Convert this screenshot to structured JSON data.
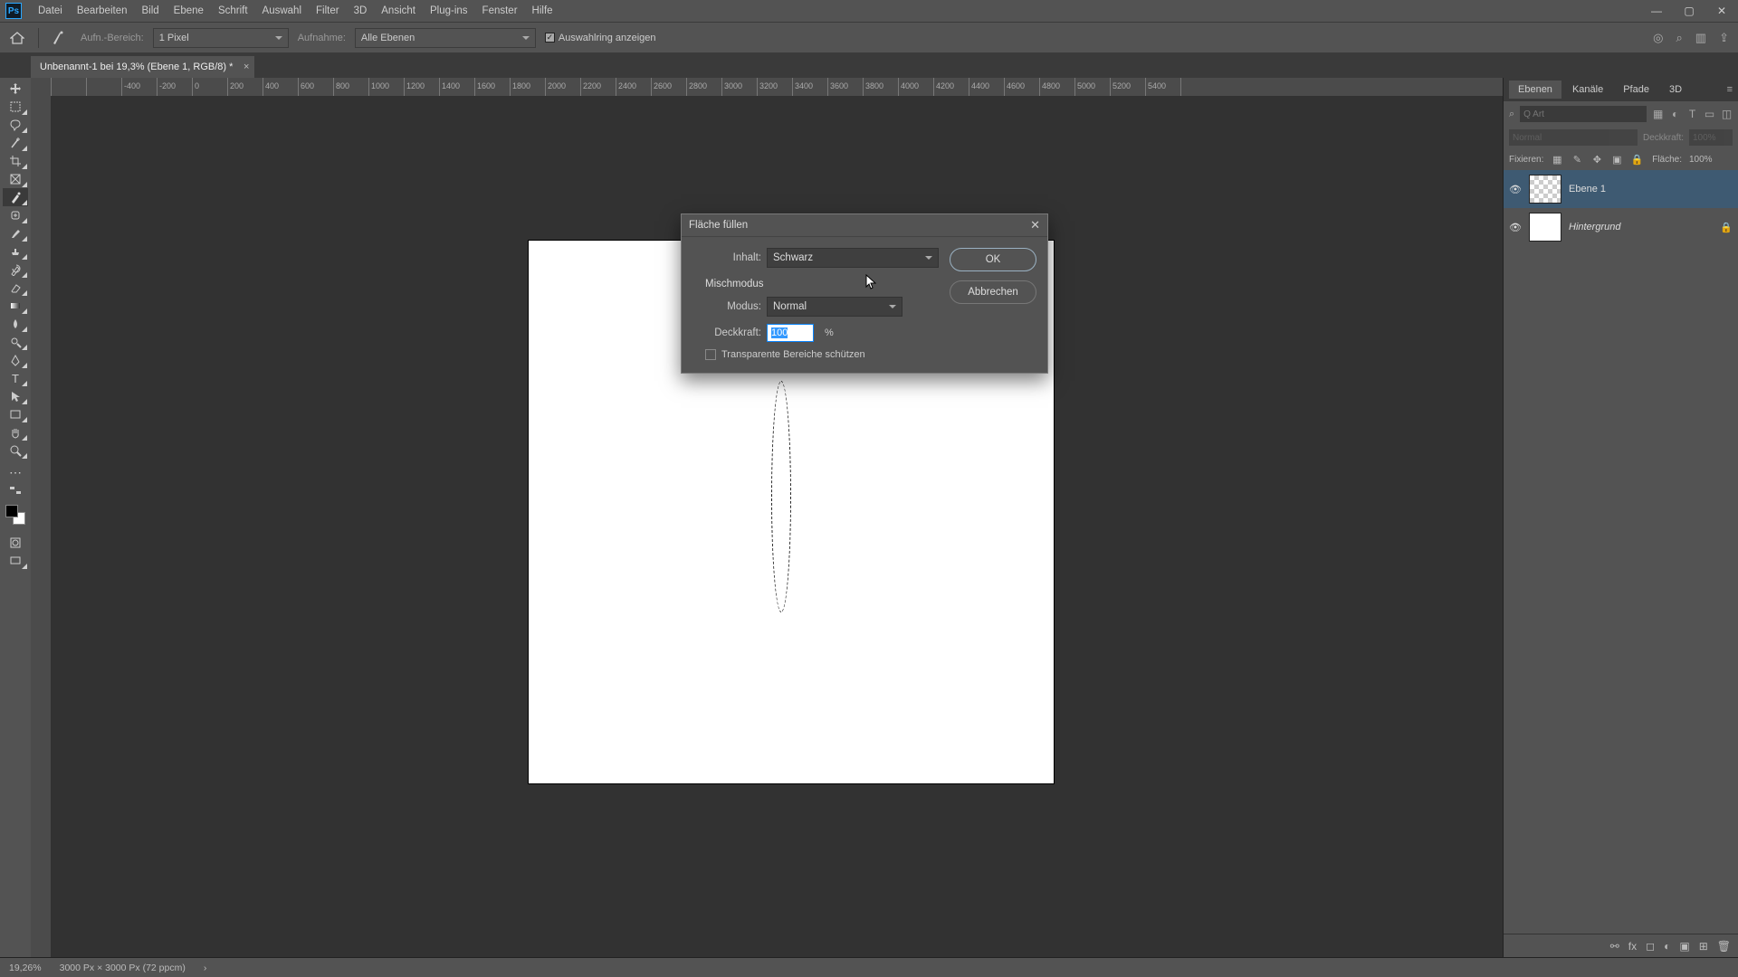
{
  "menu": [
    "Datei",
    "Bearbeiten",
    "Bild",
    "Ebene",
    "Schrift",
    "Auswahl",
    "Filter",
    "3D",
    "Ansicht",
    "Plug-ins",
    "Fenster",
    "Hilfe"
  ],
  "optbar": {
    "aufn_label": "Aufn.-Bereich:",
    "aufn_value": "1 Pixel",
    "aufnahme_label": "Aufnahme:",
    "aufnahme_value": "Alle Ebenen",
    "checkbox_label": "Auswahlring anzeigen"
  },
  "doc_tab": {
    "label": "Unbenannt-1 bei 19,3% (Ebene 1, RGB/8) *"
  },
  "ruler_ticks": [
    "",
    "",
    "-400",
    "-200",
    "0",
    "200",
    "400",
    "600",
    "800",
    "1000",
    "1200",
    "1400",
    "1600",
    "1800",
    "2000",
    "2200",
    "2400",
    "2600",
    "2800",
    "3000",
    "3200",
    "3400",
    "3600",
    "3800",
    "4000",
    "4200",
    "4400",
    "4600",
    "4800",
    "5000",
    "5200",
    "5400",
    ""
  ],
  "panels": {
    "tabs": [
      "Ebenen",
      "Kanäle",
      "Pfade",
      "3D"
    ],
    "search_placeholder": "Q Art",
    "blend_mode": "Normal",
    "opacity_label": "Deckkraft:",
    "opacity_value": "100%",
    "lock_label": "Fixieren:",
    "fill_label": "Fläche:",
    "fill_value": "100%",
    "layers": [
      {
        "name": "Ebene 1",
        "selected": true,
        "locked": false,
        "checker": true
      },
      {
        "name": "Hintergrund",
        "selected": false,
        "locked": true,
        "italic": true,
        "checker": false
      }
    ]
  },
  "dialog": {
    "title": "Fläche füllen",
    "inhalt_label": "Inhalt:",
    "inhalt_value": "Schwarz",
    "group_label": "Mischmodus",
    "modus_label": "Modus:",
    "modus_value": "Normal",
    "deckkraft_label": "Deckkraft:",
    "deckkraft_value": "100",
    "percent": "%",
    "checkbox_label": "Transparente Bereiche schützen",
    "ok": "OK",
    "cancel": "Abbrechen"
  },
  "status": {
    "zoom": "19,26%",
    "doc_size": "3000 Px × 3000 Px (72 ppcm)"
  }
}
